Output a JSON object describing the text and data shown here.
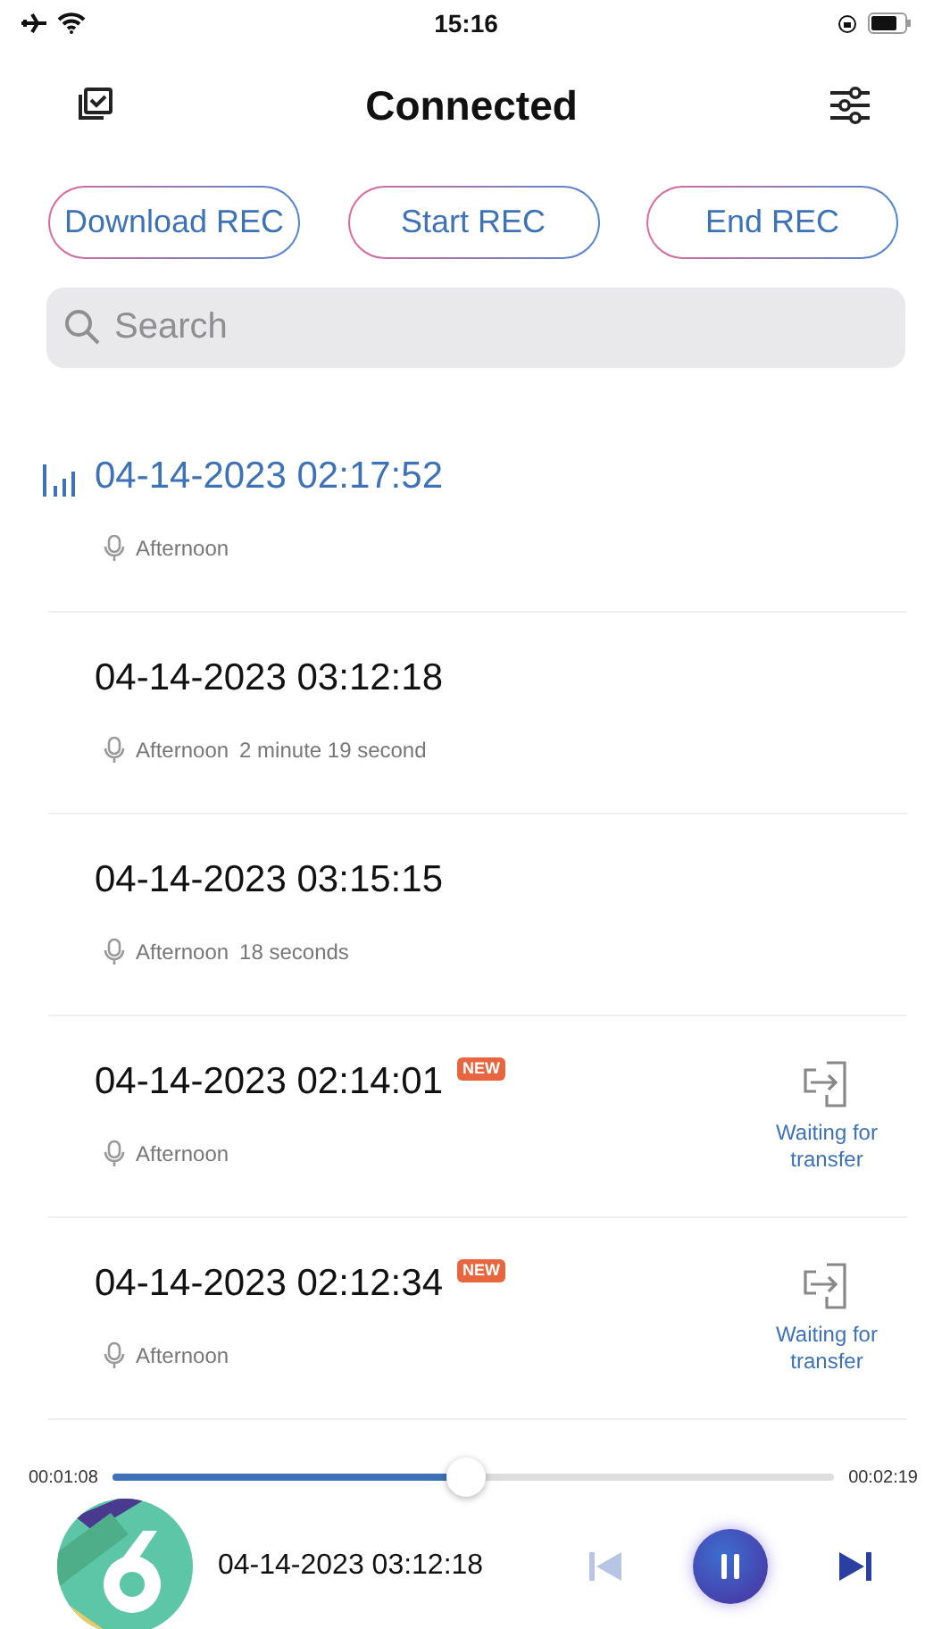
{
  "status_bar": {
    "time": "15:16"
  },
  "header": {
    "title": "Connected"
  },
  "actions": [
    "Download REC",
    "Start REC",
    "End REC"
  ],
  "search": {
    "placeholder": "Search"
  },
  "recordings": [
    {
      "title": "04-14-2023 02:17:52",
      "place": "Afternoon",
      "selected": true
    },
    {
      "title": "04-14-2023 03:12:18",
      "place": "Afternoon",
      "duration": "2 minute 19 second",
      "selected": false
    },
    {
      "title": "04-14-2023 03:15:15",
      "place": "Afternoon",
      "duration": "18 seconds",
      "selected": false
    },
    {
      "title": "04-14-2023 02:14:01",
      "place": "Afternoon",
      "selected": false,
      "badge": "NEW",
      "status": "Waiting for transfer"
    },
    {
      "title": "04-14-2023 02:12:34",
      "place": "Afternoon",
      "selected": false,
      "badge": "NEW",
      "status": "Waiting for transfer"
    }
  ],
  "player": {
    "elapsed": "00:01:08",
    "total": "00:02:19",
    "level": 0.49,
    "title": "04-14-2023 03:12:18",
    "playing": true
  }
}
